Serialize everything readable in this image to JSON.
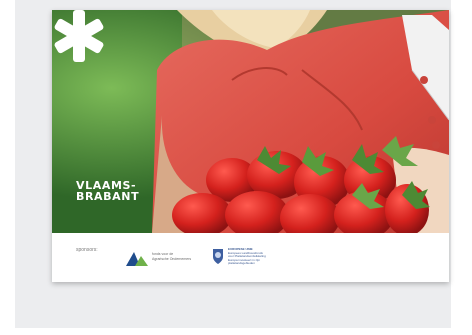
{
  "brand": {
    "line1": "VLAAMS-",
    "line2": "BRABANT",
    "logo_icon": "asterisk-star-logo"
  },
  "footer": {
    "label": "sponsors:",
    "sponsor1": {
      "icon": "triangle-logo-icon",
      "line1": "fonds voor de ",
      "line2": "Agrarische Ondernemers"
    },
    "sponsor2": {
      "icon": "crest-icon",
      "line1": "EUROPESE UNIE",
      "line2": "Europees Landbouwfonds",
      "line3": "voor Plattelandsontwikkeling",
      "line4": "Europa investeert in zijn",
      "line5": "plattelandsgebieden"
    }
  },
  "colors": {
    "panel_bg": "#ecedef",
    "shirt_red": "#d9534a",
    "strawberry_red": "#c0201f",
    "leaf_green": "#4d8a34"
  }
}
